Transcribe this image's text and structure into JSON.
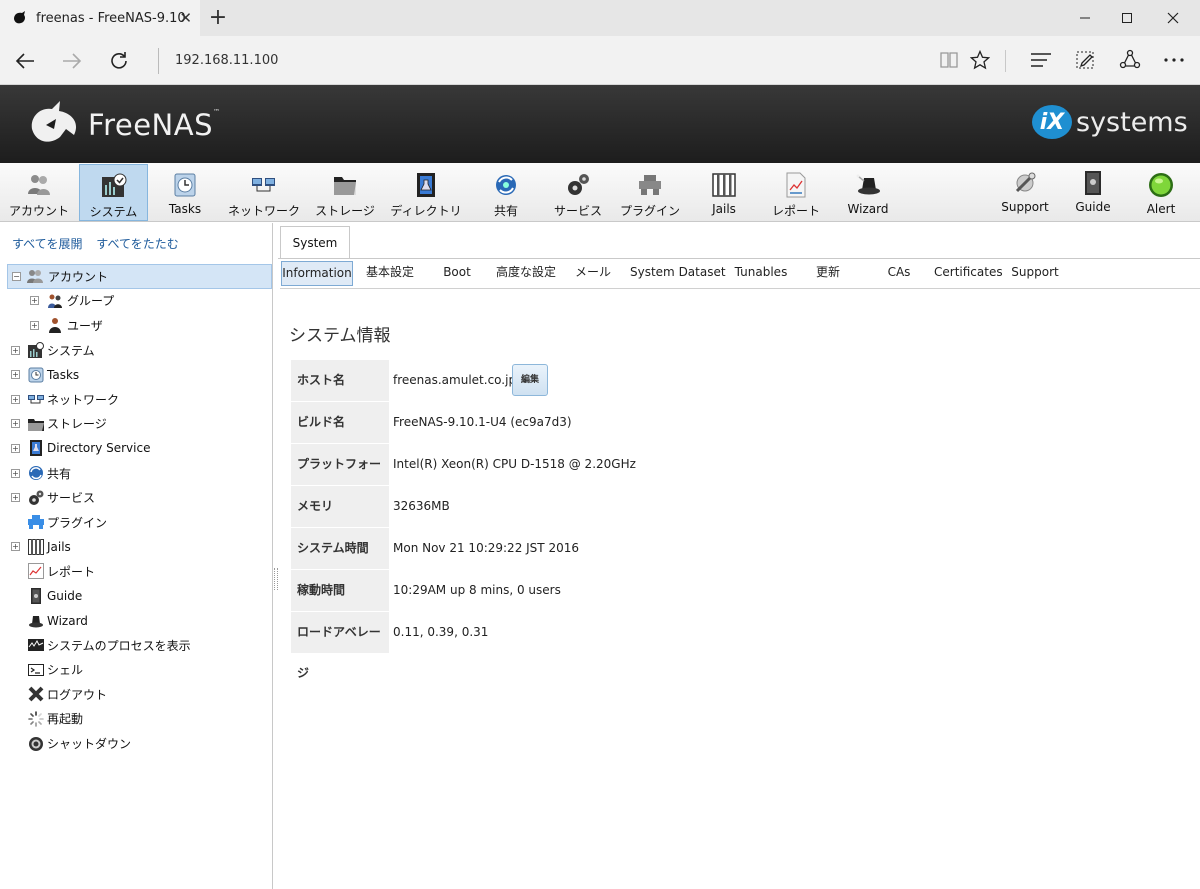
{
  "browser": {
    "tab_title": "freenas - FreeNAS-9.10.",
    "url": "192.168.11.100"
  },
  "header": {
    "logo_text": "FreeNAS",
    "logo_tm": "™",
    "vendor_badge": "iX",
    "vendor_text": "systems"
  },
  "toolbar": {
    "items": [
      {
        "label": "アカウント",
        "icon": "users-icon"
      },
      {
        "label": "システム",
        "icon": "system-icon",
        "active": true
      },
      {
        "label": "Tasks",
        "icon": "tasks-icon"
      },
      {
        "label": "ネットワーク",
        "icon": "network-icon"
      },
      {
        "label": "ストレージ",
        "icon": "storage-icon"
      },
      {
        "label": "ディレクトリ",
        "icon": "directory-icon"
      },
      {
        "label": "共有",
        "icon": "sharing-icon"
      },
      {
        "label": "サービス",
        "icon": "services-icon"
      },
      {
        "label": "プラグイン",
        "icon": "plugins-icon"
      },
      {
        "label": "Jails",
        "icon": "jails-icon"
      },
      {
        "label": "レポート",
        "icon": "reports-icon"
      },
      {
        "label": "Wizard",
        "icon": "wizard-icon"
      },
      {
        "label": "Support",
        "icon": "support-icon"
      },
      {
        "label": "Guide",
        "icon": "guide-icon"
      },
      {
        "label": "Alert",
        "icon": "alert-icon"
      }
    ]
  },
  "sidebar": {
    "expand_all": "すべてを展開",
    "collapse_all": "すべてをたたむ",
    "nodes": [
      {
        "label": "アカウント",
        "icon": "users-icon"
      },
      {
        "label": "グループ",
        "icon": "group-icon"
      },
      {
        "label": "ユーザ",
        "icon": "user-icon"
      },
      {
        "label": "システム",
        "icon": "system-icon"
      },
      {
        "label": "Tasks",
        "icon": "tasks-icon"
      },
      {
        "label": "ネットワーク",
        "icon": "network-icon"
      },
      {
        "label": "ストレージ",
        "icon": "storage-icon"
      },
      {
        "label": "Directory Service",
        "icon": "directory-icon"
      },
      {
        "label": "共有",
        "icon": "sharing-icon"
      },
      {
        "label": "サービス",
        "icon": "services-icon"
      },
      {
        "label": "プラグイン",
        "icon": "plugins-icon"
      },
      {
        "label": "Jails",
        "icon": "jails-icon"
      },
      {
        "label": "レポート",
        "icon": "reports-icon"
      },
      {
        "label": "Guide",
        "icon": "guide-icon"
      },
      {
        "label": "Wizard",
        "icon": "wizard-icon"
      },
      {
        "label": "システムのプロセスを表示",
        "icon": "process-icon"
      },
      {
        "label": "シェル",
        "icon": "shell-icon"
      },
      {
        "label": "ログアウト",
        "icon": "logout-icon"
      },
      {
        "label": "再起動",
        "icon": "reboot-icon"
      },
      {
        "label": "シャットダウン",
        "icon": "shutdown-icon"
      }
    ]
  },
  "main": {
    "tab": "System",
    "subtabs": [
      {
        "label": "Information",
        "active": true
      },
      {
        "label": "基本設定"
      },
      {
        "label": "Boot"
      },
      {
        "label": "高度な設定"
      },
      {
        "label": "メール"
      },
      {
        "label": "System Dataset"
      },
      {
        "label": "Tunables"
      },
      {
        "label": "更新"
      },
      {
        "label": "CAs"
      },
      {
        "label": "Certificates"
      },
      {
        "label": "Support"
      }
    ],
    "section_title": "システム情報",
    "edit_label": "編集",
    "rows": [
      {
        "label": "ホスト名",
        "value": "freenas.amulet.co.jp"
      },
      {
        "label": "ビルド名",
        "value": "FreeNAS-9.10.1-U4 (ec9a7d3)"
      },
      {
        "label": "プラットフォーム",
        "value": "Intel(R) Xeon(R) CPU D-1518 @ 2.20GHz"
      },
      {
        "label": "メモリ",
        "value": "32636MB"
      },
      {
        "label": "システム時間",
        "value": "Mon Nov 21 10:29:22 JST 2016"
      },
      {
        "label": "稼動時間",
        "value": "10:29AM up 8 mins, 0 users"
      },
      {
        "label": "ロードアベレージ",
        "value": "0.11, 0.39, 0.31"
      }
    ]
  },
  "colors": {
    "active_tab_bg": "#bfd9ef",
    "link": "#1d5a9b",
    "ix_blue": "#1f8fd1"
  }
}
